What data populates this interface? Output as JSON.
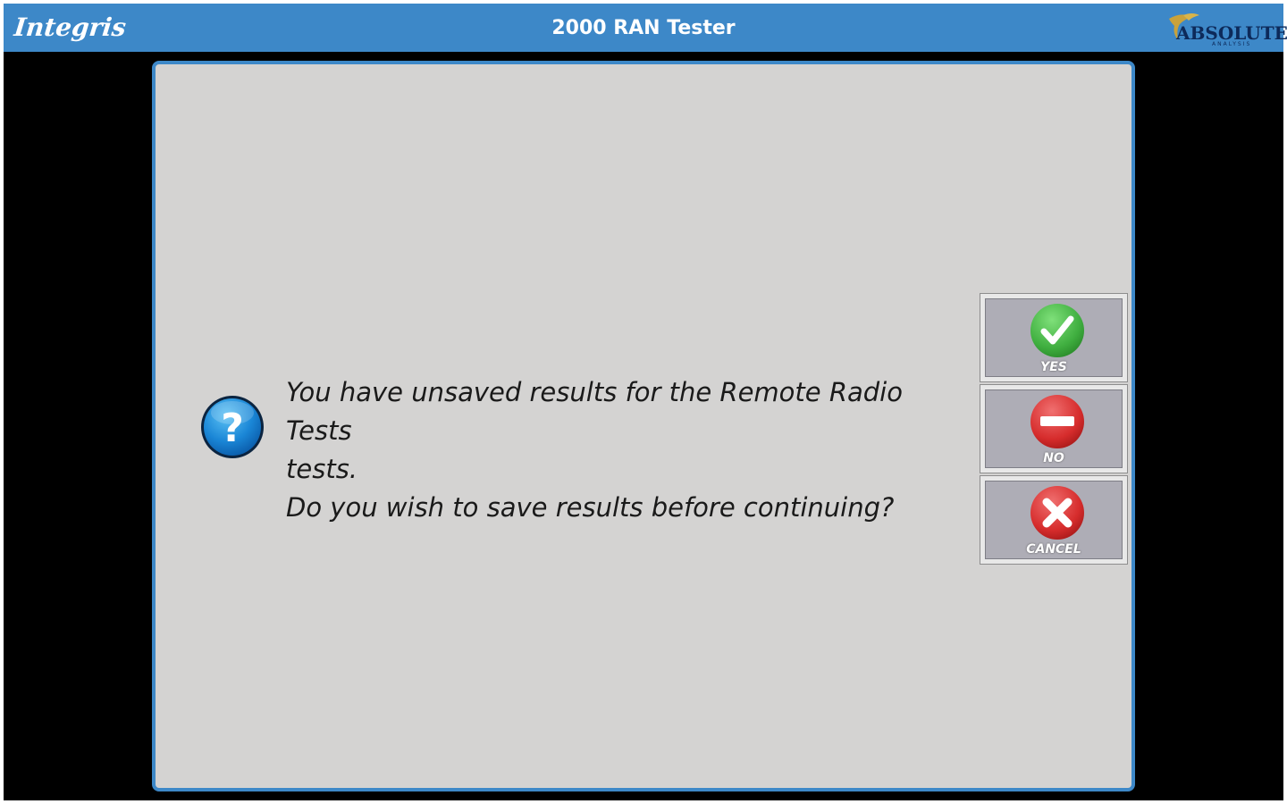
{
  "titlebar": {
    "brand_left": "Integris",
    "title": "2000 RAN Tester",
    "brand_right": "ABSOLUTE",
    "brand_right_sub": "ANALYSIS"
  },
  "dialog": {
    "icon": "question-icon",
    "message_lines": [
      "You have unsaved results for the Remote Radio Tests",
      "tests.",
      "Do you wish to save results before continuing?"
    ],
    "buttons": [
      {
        "label": "YES",
        "icon": "checkmark-icon",
        "color": "#3fae3f"
      },
      {
        "label": "NO",
        "icon": "minus-icon",
        "color": "#d62c2c"
      },
      {
        "label": "CANCEL",
        "icon": "x-icon",
        "color": "#d62c2c"
      }
    ]
  },
  "colors": {
    "titlebar": "#3d88c8",
    "dialog_bg": "#d4d3d2",
    "dialog_border": "#3d88c8",
    "button_face": "#aeadb6",
    "workarea": "#000000"
  }
}
